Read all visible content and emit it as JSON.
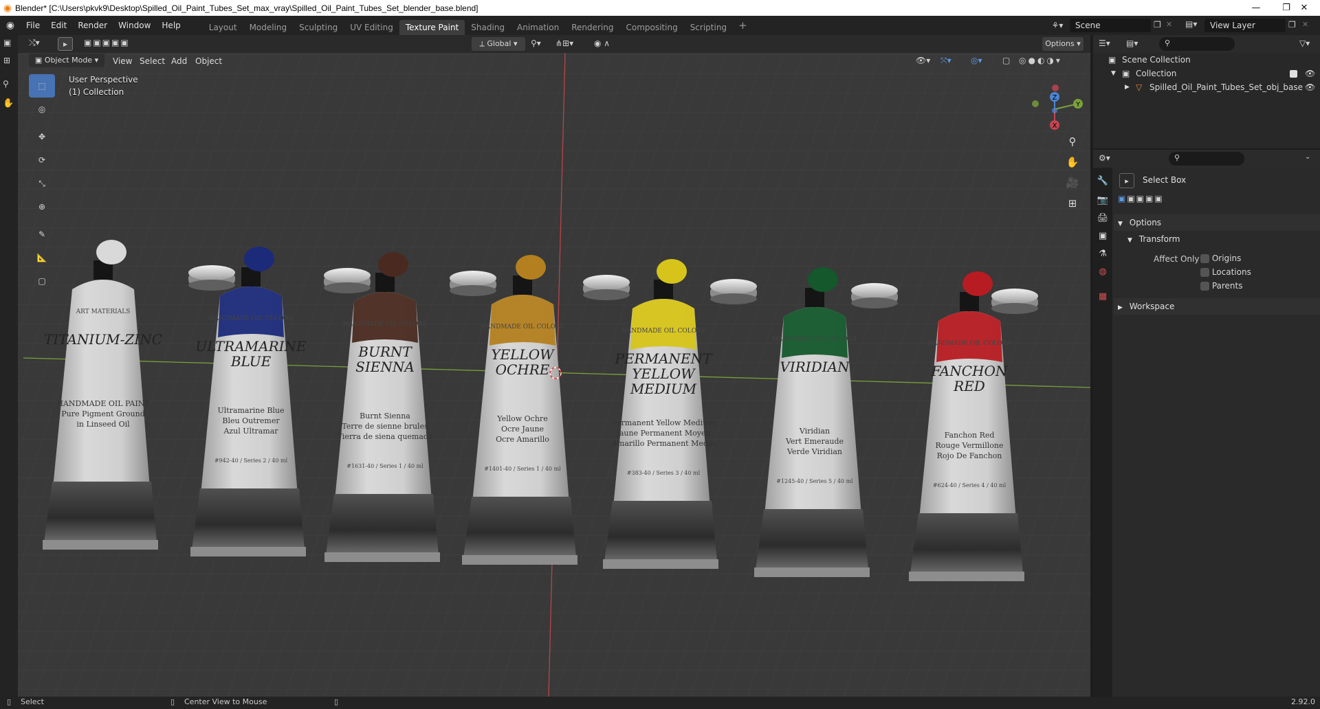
{
  "window": {
    "title": "Blender* [C:\\Users\\pkvk9\\Desktop\\Spilled_Oil_Paint_Tubes_Set_max_vray\\Spilled_Oil_Paint_Tubes_Set_blender_base.blend]",
    "minimize": "—",
    "maximize": "❐",
    "close": "✕"
  },
  "menu": [
    "File",
    "Edit",
    "Render",
    "Window",
    "Help"
  ],
  "workspaces": [
    "Layout",
    "Modeling",
    "Sculpting",
    "UV Editing",
    "Texture Paint",
    "Shading",
    "Animation",
    "Rendering",
    "Compositing",
    "Scripting"
  ],
  "active_workspace": "Texture Paint",
  "scene": {
    "name": "Scene",
    "view_layer": "View Layer"
  },
  "viewport": {
    "mode": "Object Mode",
    "menus": [
      "View",
      "Select",
      "Add",
      "Object"
    ],
    "orientation": "Global",
    "options_label": "Options",
    "perspective_label": "User Perspective",
    "collection_label": "(1) Collection",
    "gizmo_axes": {
      "x": "X",
      "y": "Y",
      "z": "Z"
    }
  },
  "tubes": [
    {
      "name": "TITANIUM-ZINC",
      "subtitle": "ART MATERIALS",
      "lines": [
        "HANDMADE OIL PAINT",
        "Pure Pigment Ground",
        "in Linseed Oil"
      ],
      "code": "",
      "cap_color": "#d9d9d9"
    },
    {
      "name": "ULTRAMARINE BLUE",
      "subtitle": "HANDMADE OIL COLORS",
      "lines": [
        "Ultramarine Blue",
        "Bleu Outremer",
        "Azul Ultramar"
      ],
      "code": "#942-40 / Series 2 / 40 ml",
      "cap_color": "#1c2a7a"
    },
    {
      "name": "BURNT SIENNA",
      "subtitle": "HANDMADE OIL COLORS",
      "lines": [
        "Burnt Sienna",
        "Terre de sienne brules",
        "Tierra de siena quemada"
      ],
      "code": "#1631-40 / Series 1 / 40 ml",
      "cap_color": "#4a2a20"
    },
    {
      "name": "YELLOW OCHRE",
      "subtitle": "HANDMADE OIL COLORS",
      "lines": [
        "Yellow Ochre",
        "Ocre Jaune",
        "Ocre Amarillo"
      ],
      "code": "#1401-40 / Series 1 / 40 ml",
      "cap_color": "#b4801f"
    },
    {
      "name": "PERMANENT YELLOW MEDIUM",
      "subtitle": "HANDMADE OIL COLORS",
      "lines": [
        "Permanent Yellow Medium",
        "Jaune Permanent Moyen",
        "Amarillo Permanent Medio"
      ],
      "code": "#383-40 / Series 3 / 40 ml",
      "cap_color": "#d7c41a"
    },
    {
      "name": "VIRIDIAN",
      "subtitle": "HANDMADE OIL COLORS",
      "lines": [
        "Viridian",
        "Vert Emeraude",
        "Verde Viridian"
      ],
      "code": "#1245-40 / Series 5 / 40 ml",
      "cap_color": "#14582c"
    },
    {
      "name": "FANCHON RED",
      "subtitle": "HANDMADE OIL COLORS",
      "lines": [
        "Fanchon Red",
        "Rouge Vermillone",
        "Rojo De Fanchon"
      ],
      "code": "#624-40 / Series 4 / 40 ml",
      "cap_color": "#b61c22"
    }
  ],
  "outliner": {
    "root": "Scene Collection",
    "collection": "Collection",
    "object": "Spilled_Oil_Paint_Tubes_Set_obj_base"
  },
  "properties": {
    "tool_name": "Select Box",
    "options_panel": "Options",
    "transform_panel": "Transform",
    "affect_only_label": "Affect Only",
    "checkboxes": [
      "Origins",
      "Locations",
      "Parents"
    ],
    "workspace_panel": "Workspace"
  },
  "status": {
    "left_action": "Select",
    "middle_action": "Center View to Mouse",
    "version": "2.92.0"
  }
}
